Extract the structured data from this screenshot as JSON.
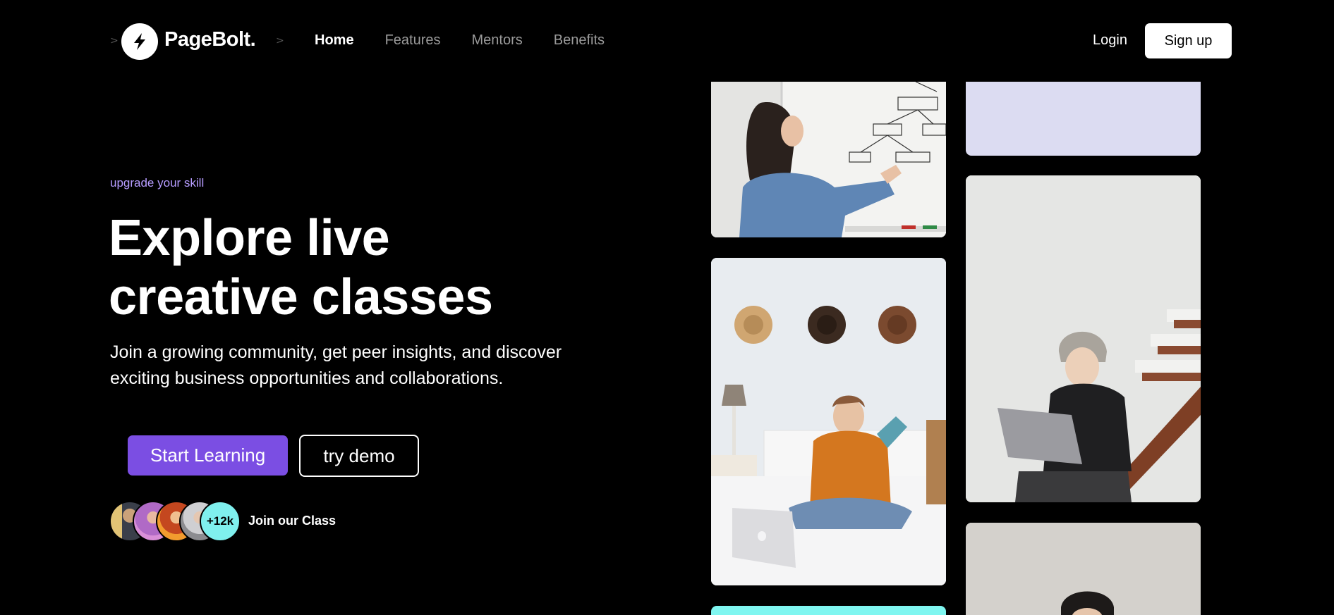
{
  "brand": {
    "name": "PageBolt.",
    "logo_icon": "bolt-icon"
  },
  "nav": {
    "items": [
      {
        "label": "Home",
        "active": true
      },
      {
        "label": "Features",
        "active": false
      },
      {
        "label": "Mentors",
        "active": false
      },
      {
        "label": "Benefits",
        "active": false
      }
    ],
    "login_label": "Login",
    "signup_label": "Sign up"
  },
  "hero": {
    "eyebrow": "upgrade your skill",
    "headline_line1": "Explore live",
    "headline_line2": "creative classes",
    "sub_line1": "Join a growing community, get peer insights, and discover",
    "sub_line2": "exciting business opportunities and collaborations.",
    "primary_cta": "Start Learning",
    "secondary_cta": "try demo",
    "member_count": "+12k",
    "join_label": "Join our Class"
  },
  "colors": {
    "accent": "#7b4ee3",
    "eyebrow": "#b69cff",
    "count_badge": "#7ff0ee",
    "lavender_tile": "#dcdcf2",
    "cyan_tile": "#7ff6f0"
  },
  "gallery": [
    {
      "name": "woman-at-whiteboard"
    },
    {
      "name": "lavender-panel"
    },
    {
      "name": "man-on-bed-reading"
    },
    {
      "name": "person-with-laptop-on-stairs"
    },
    {
      "name": "woman-with-glasses"
    },
    {
      "name": "cyan-panel"
    }
  ]
}
